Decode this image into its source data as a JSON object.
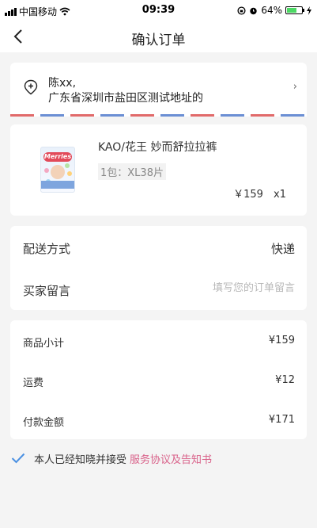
{
  "status_bar": {
    "carrier": "中国移动",
    "time": "09:39",
    "battery": "64%",
    "battery_level": 0.64,
    "icons": [
      "signal-icon",
      "wifi-icon",
      "rotation-lock-icon",
      "alarm-icon",
      "battery-icon",
      "charging-icon"
    ]
  },
  "nav": {
    "back_icon": "back-chevron-icon",
    "title": "确认订单"
  },
  "address": {
    "icon": "location-pin-icon",
    "name": "陈xx,",
    "detail": "广东省深圳市盐田区测试地址的",
    "chevron": "›",
    "stripe_colors": [
      "#e16a6a",
      "#6b8fd4"
    ]
  },
  "product": {
    "name": "KAO/花王 妙而舒拉拉裤",
    "spec": "1包：XL38片",
    "price": "￥159",
    "quantity": "x1"
  },
  "delivery": {
    "method_label": "配送方式",
    "method_value": "快递",
    "note_label": "买家留言",
    "note_placeholder": "填写您的订单留言",
    "note_value": ""
  },
  "summary": {
    "subtotal_label": "商品小计",
    "subtotal_value": "¥159",
    "shipping_label": "运费",
    "shipping_value": "¥12",
    "total_label": "付款金额",
    "total_value": "¥171"
  },
  "agreement": {
    "checked": true,
    "text": "本人已经知晓并接受",
    "link": "服务协议及告知书",
    "accent_color": "#4a90e2",
    "link_color": "#d9628a"
  }
}
